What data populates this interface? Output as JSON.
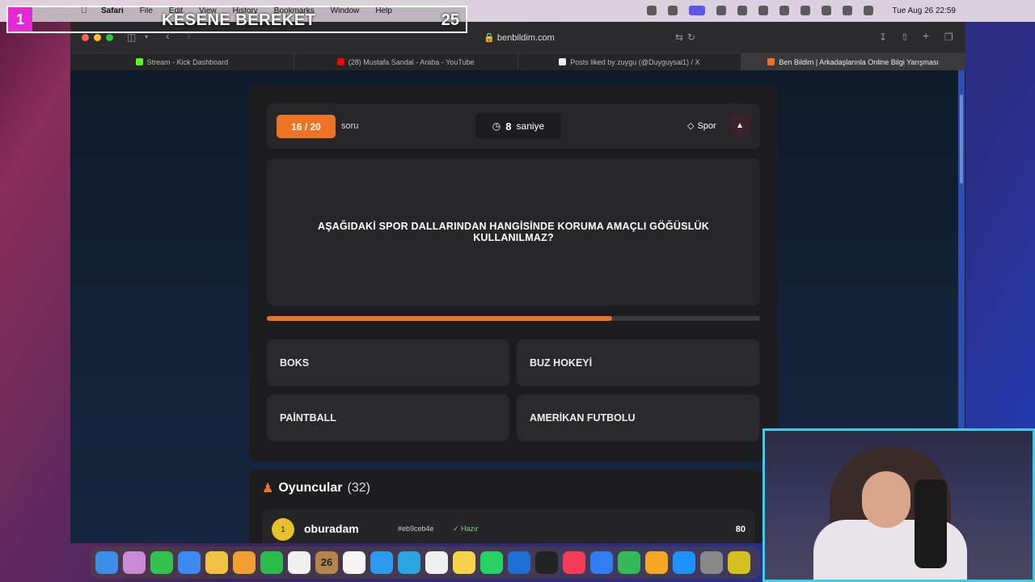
{
  "menubar": {
    "app": "Safari",
    "items": [
      "File",
      "Edit",
      "View",
      "History",
      "Bookmarks",
      "Window",
      "Help"
    ],
    "clock": "Tue Aug 26  22:59"
  },
  "overlay": {
    "rank": "1",
    "name": "KESENE BEREKET",
    "score": "25"
  },
  "browser": {
    "url": "benbildim.com",
    "tabs": [
      {
        "label": "Stream - Kick Dashboard",
        "color": "#53fc18"
      },
      {
        "label": "(28) Mustafa Sandal - Araba - YouTube",
        "color": "#ff0000"
      },
      {
        "label": "Posts liked by zuygu (@Duyguysal1) / X",
        "color": "#eeeeee"
      },
      {
        "label": "Ben Bildim | Arkadaşlarınla Online Bilgi Yarışması",
        "color": "#f07323"
      }
    ]
  },
  "quiz": {
    "counter": "16 / 20",
    "counter_suffix": "soru",
    "timer_value": "8",
    "timer_unit": "saniye",
    "category": "Spor",
    "question": "AŞAĞIDAKİ SPOR DALLARINDAN HANGİSİNDE KORUMA AMAÇLI GÖĞÜSLÜK KULLANILMAZ?",
    "progress_fraction": 0.7,
    "answers": [
      "BOKS",
      "BUZ HOKEYİ",
      "PAİNTBALL",
      "AMERİKAN FUTBOLU"
    ]
  },
  "players": {
    "title": "Oyuncular",
    "count": "(32)",
    "rows": [
      {
        "rank": "1",
        "name": "oburadam",
        "id": "#eb9ceb4e",
        "status": "Hazır",
        "score": "80"
      }
    ]
  },
  "dock": {
    "calendar_day": "26",
    "app_colors": [
      "#3b8fe8",
      "#c98ad6",
      "#33c24d",
      "#3d8bf2",
      "#f0c040",
      "#f0a030",
      "#2dbb4e",
      "#f0f0f0",
      "#b5854a",
      "#f5f5f5",
      "#2e9bf0",
      "#2aa5e0",
      "#f0f0f0",
      "#f5d24a",
      "#25d366",
      "#1f6fd6",
      "#222222",
      "#f43c5a",
      "#2f7df0",
      "#35b857",
      "#f5a623",
      "#1e90ff",
      "#888888",
      "#d4c020"
    ]
  }
}
